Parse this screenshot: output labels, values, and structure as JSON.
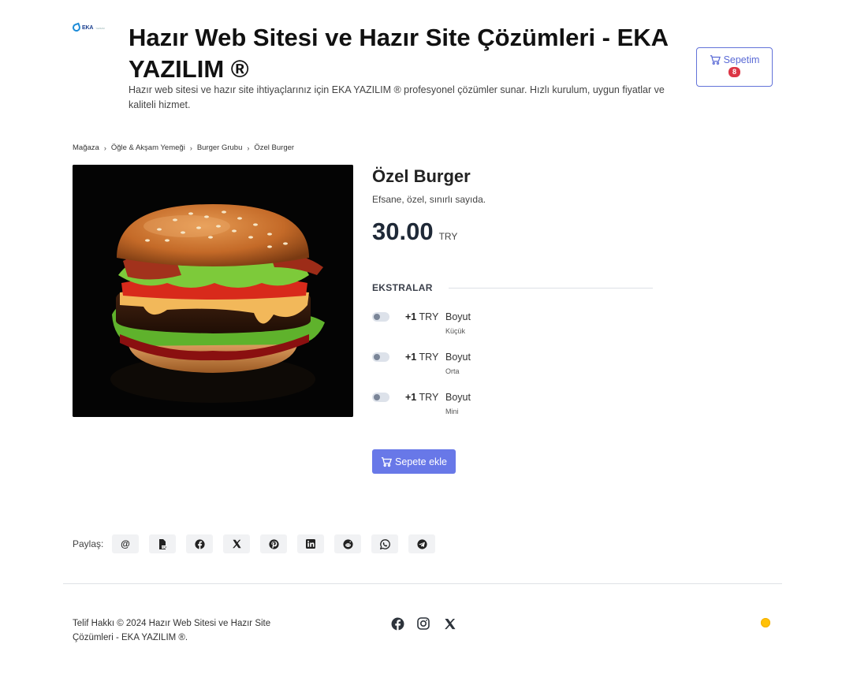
{
  "header": {
    "logo_text": "EKA",
    "logo_subtext": "YAZILIM",
    "title": "Hazır Web Sitesi ve Hazır Site Çözümleri - EKA YAZILIM ®",
    "description": "Hazır web sitesi ve hazır site ihtiyaçlarınız için EKA YAZILIM ® profesyonel çözümler sunar. Hızlı kurulum, uygun fiyatlar ve kaliteli hizmet.",
    "cart_label": "Sepetim",
    "cart_count": "8"
  },
  "breadcrumb": [
    "Mağaza",
    "Öğle & Akşam Yemeği",
    "Burger Grubu",
    "Özel Burger"
  ],
  "breadcrumb_separator": "›",
  "product": {
    "name": "Özel Burger",
    "tagline": "Efsane, özel, sınırlı sayıda.",
    "price": "30.00",
    "currency": "TRY",
    "extras_label": "EKSTRALAR",
    "extras": [
      {
        "amount": "+1",
        "currency": "TRY",
        "name": "Boyut",
        "option": "Küçük",
        "enabled": false
      },
      {
        "amount": "+1",
        "currency": "TRY",
        "name": "Boyut",
        "option": "Orta",
        "enabled": false
      },
      {
        "amount": "+1",
        "currency": "TRY",
        "name": "Boyut",
        "option": "Mini",
        "enabled": false
      }
    ],
    "add_to_cart_label": "Sepete ekle"
  },
  "share": {
    "label": "Paylaş:",
    "buttons": [
      "email-icon",
      "pdf-icon",
      "facebook-icon",
      "x-icon",
      "pinterest-icon",
      "linkedin-icon",
      "reddit-icon",
      "whatsapp-icon",
      "telegram-icon"
    ]
  },
  "footer": {
    "copyright": "Telif Hakkı © 2024 Hazır Web Sitesi ve Hazır Site Çözümleri - EKA YAZILIM ®.",
    "social": [
      "facebook-icon",
      "instagram-icon",
      "x-icon"
    ]
  },
  "colors": {
    "accent": "#6878e8",
    "badge": "#dc3545",
    "theme_toggle": "#ffc107"
  }
}
